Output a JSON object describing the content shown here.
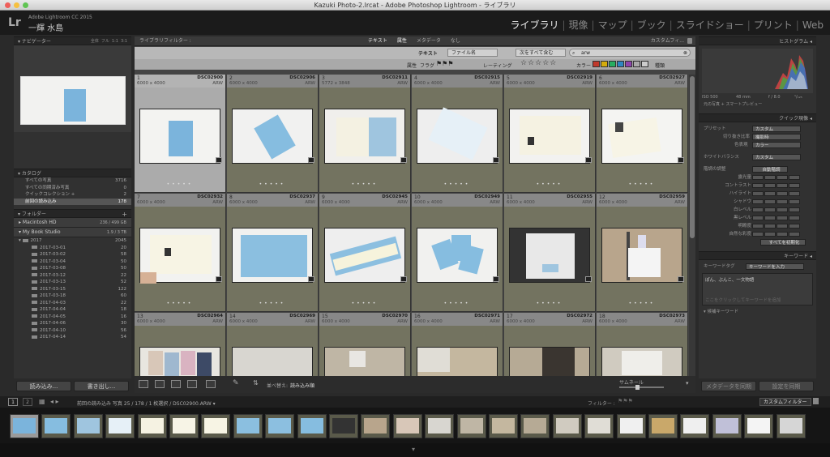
{
  "window": {
    "title": "Kazuki Photo-2.lrcat - Adobe Photoshop Lightroom - ライブラリ"
  },
  "identity": {
    "logo": "Lr",
    "app_name": "Adobe Lightroom CC 2015",
    "user_name": "一輝 水島"
  },
  "modules": [
    {
      "label": "ライブラリ",
      "active": true
    },
    {
      "label": "現像",
      "active": false
    },
    {
      "label": "マップ",
      "active": false
    },
    {
      "label": "ブック",
      "active": false
    },
    {
      "label": "スライドショー",
      "active": false
    },
    {
      "label": "プリント",
      "active": false
    },
    {
      "label": "Web",
      "active": false
    }
  ],
  "left_panel": {
    "navigator": {
      "title": "ナビゲーター",
      "zoom_options": [
        "全体",
        "フル",
        "1:1",
        "3:1"
      ]
    },
    "catalog": {
      "title": "カタログ",
      "items": [
        {
          "label": "すべての写真",
          "count": "3716"
        },
        {
          "label": "すべての同期済み写真",
          "count": "0"
        },
        {
          "label": "クイックコレクション +",
          "count": "2"
        },
        {
          "label": "前回の読み込み",
          "count": "178"
        }
      ]
    },
    "folders": {
      "title": "フォルダー",
      "add": "+",
      "volumes": [
        {
          "label": "Macintosh HD",
          "info": "236 / 499 GB"
        },
        {
          "label": "My Book Studio",
          "info": "1.9 / 3 TB"
        }
      ],
      "root": {
        "label": "2017",
        "count": "2045"
      },
      "items": [
        {
          "label": "2017-03-01",
          "count": "20"
        },
        {
          "label": "2017-03-02",
          "count": "58"
        },
        {
          "label": "2017-03-04",
          "count": "50"
        },
        {
          "label": "2017-03-08",
          "count": "50"
        },
        {
          "label": "2017-03-12",
          "count": "22"
        },
        {
          "label": "2017-03-13",
          "count": "52"
        },
        {
          "label": "2017-03-15",
          "count": "122"
        },
        {
          "label": "2017-03-18",
          "count": "60"
        },
        {
          "label": "2017-04-03",
          "count": "22"
        },
        {
          "label": "2017-04-04",
          "count": "18"
        },
        {
          "label": "2017-04-05",
          "count": "16"
        },
        {
          "label": "2017-04-06",
          "count": "30"
        },
        {
          "label": "2017-04-10",
          "count": "56"
        },
        {
          "label": "2017-04-14",
          "count": "54"
        }
      ]
    },
    "buttons": {
      "import": "読み込み...",
      "export": "書き出し..."
    }
  },
  "library_filter": {
    "title": "ライブラリフィルター :",
    "tabs": [
      "テキスト",
      "属性",
      "メタデータ",
      "なし"
    ],
    "preset": "カスタムフィ...",
    "text": {
      "label": "テキスト",
      "field": "ファイル名",
      "rule": "次をすべて含む",
      "search": "arw"
    },
    "attribute": {
      "label": "属性",
      "flag": "フラグ",
      "rating": "レーティング",
      "stars": "☆☆☆☆☆",
      "color": "カラー",
      "kind": "種類"
    },
    "label_colors": [
      "#c0392b",
      "#d4ac0d",
      "#27ae60",
      "#2e86c1",
      "#8e44ad",
      "#aaaaaa",
      "#cccccc"
    ]
  },
  "grid": {
    "cells": [
      {
        "num": "1",
        "file": "DSC02900",
        "dims": "6000 x 4000",
        "ext": "ARW",
        "selected": true
      },
      {
        "num": "2",
        "file": "DSC02906",
        "dims": "6000 x 4000",
        "ext": "ARW"
      },
      {
        "num": "3",
        "file": "DSC02911",
        "dims": "5772 x 3848",
        "ext": "ARW"
      },
      {
        "num": "4",
        "file": "DSC02915",
        "dims": "6000 x 4000",
        "ext": "ARW"
      },
      {
        "num": "5",
        "file": "DSC02919",
        "dims": "6000 x 4000",
        "ext": "ARW"
      },
      {
        "num": "6",
        "file": "DSC02927",
        "dims": "6000 x 4000",
        "ext": "ARW"
      },
      {
        "num": "7",
        "file": "DSC02932",
        "dims": "6000 x 4000",
        "ext": "ARW"
      },
      {
        "num": "8",
        "file": "DSC02937",
        "dims": "6000 x 4000",
        "ext": "ARW"
      },
      {
        "num": "9",
        "file": "DSC02945",
        "dims": "6000 x 4000",
        "ext": "ARW"
      },
      {
        "num": "10",
        "file": "DSC02949",
        "dims": "6000 x 4000",
        "ext": "ARW"
      },
      {
        "num": "11",
        "file": "DSC02955",
        "dims": "6000 x 4000",
        "ext": "ARW"
      },
      {
        "num": "12",
        "file": "DSC02959",
        "dims": "6000 x 4000",
        "ext": "ARW"
      },
      {
        "num": "13",
        "file": "DSC02964",
        "dims": "6000 x 4000",
        "ext": "ARW"
      },
      {
        "num": "14",
        "file": "DSC02969",
        "dims": "6000 x 4000",
        "ext": "ARW"
      },
      {
        "num": "15",
        "file": "DSC02970",
        "dims": "6000 x 4000",
        "ext": "ARW"
      },
      {
        "num": "16",
        "file": "DSC02971",
        "dims": "6000 x 4000",
        "ext": "ARW"
      },
      {
        "num": "17",
        "file": "DSC02972",
        "dims": "6000 x 4000",
        "ext": "ARW"
      },
      {
        "num": "18",
        "file": "DSC02973",
        "dims": "6000 x 4000",
        "ext": "ARW"
      }
    ]
  },
  "toolbar": {
    "sort_label": "並べ替え:",
    "sort_value": "読み込み順",
    "thumb_label": "サムネール"
  },
  "right_panel": {
    "histogram": {
      "title": "ヒストグラム",
      "iso": "ISO 500",
      "focal": "48 mm",
      "fstop": "f / 8.0",
      "shutter": "¹/₁₂₅",
      "preview": "元の写真 + スマートプレビュー"
    },
    "quick_develop": {
      "title": "クイック現像",
      "preset_label": "プリセット",
      "preset_value": "カスタム",
      "crop_label": "切り抜き比率",
      "crop_value": "撮影時",
      "treatment_label": "色表現",
      "treatment_value": "カラー",
      "wb_label": "ホワイトバランス",
      "wb_value": "カスタム",
      "tone_label": "階調の調整",
      "auto_label": "自動階調",
      "sliders": [
        "露光量",
        "コントラスト",
        "ハイライト",
        "シャドウ",
        "白レベル",
        "黒レベル",
        "明瞭度",
        "自然な彩度"
      ],
      "reset": "すべてを初期化"
    },
    "keywords": {
      "title": "キーワード",
      "tags_label": "キーワードタグ",
      "tags_mode": "キーワードを入力",
      "tags_value": "ぽん、ぶんこ、一文物語",
      "placeholder": "ここをクリックしてキーワードを追加",
      "suggest": "候補キーワード"
    },
    "buttons": {
      "sync_meta": "メタデータを同期",
      "sync_settings": "設定を同期"
    }
  },
  "filmstrip": {
    "pages": [
      "1",
      "2"
    ],
    "info": "前回の読み込み   写真 25 / 178 / 1 枚選択 / DSC02900.ARW ▾",
    "filter_label": "フィルター :",
    "filter_value": "カスタムフィルター"
  }
}
